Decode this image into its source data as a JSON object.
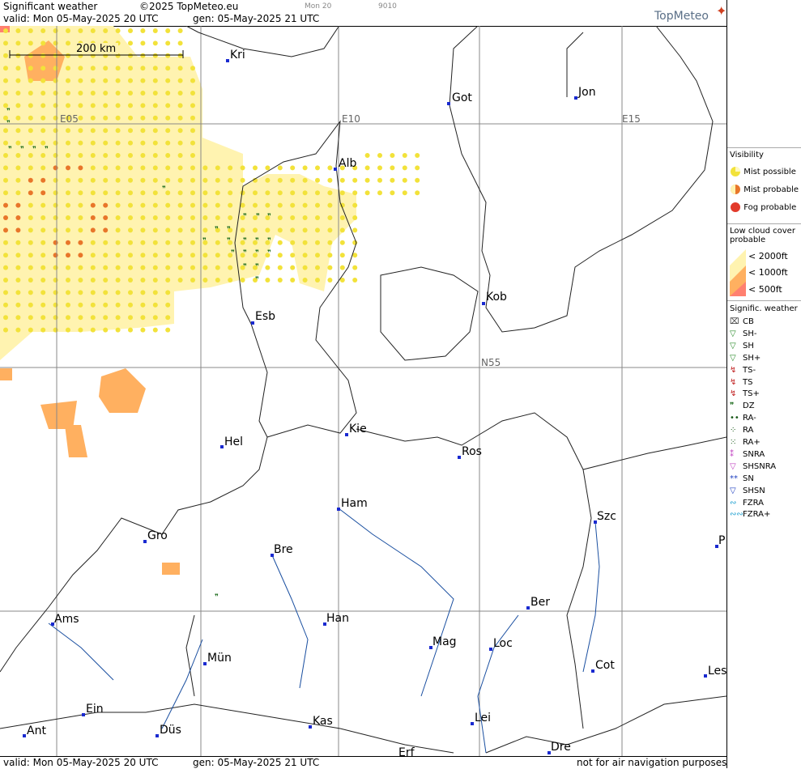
{
  "header": {
    "title": "Significant weather",
    "copyright": "©2025 TopMeteo.eu",
    "valid": "valid:  Mon  05-May-2025  20 UTC",
    "gen": "gen: 05-May-2025 21 UTC",
    "small_day": "Mon 20",
    "small_code": "9010",
    "logo": "TopMeteo"
  },
  "footer": {
    "valid": "valid:  Mon  05-May-2025  20 UTC",
    "gen": "gen: 05-May-2025 21 UTC",
    "disclaimer": "not for air navigation purposes"
  },
  "map": {
    "scale": "200 km",
    "grid_labels": [
      "E05",
      "E10",
      "E15",
      "N55"
    ],
    "cities": [
      "Kri",
      "Got",
      "Jon",
      "Alb",
      "Kob",
      "Esb",
      "Kie",
      "Hel",
      "Ros",
      "Ham",
      "Szc",
      "Gro",
      "Bre",
      "P",
      "Ams",
      "Han",
      "Ber",
      "Mag",
      "Loc",
      "Cot",
      "Mün",
      "Les",
      "Ein",
      "Kas",
      "Lei",
      "Ant",
      "Düs",
      "Dre",
      "Erf"
    ]
  },
  "legend": {
    "visibility_title": "Visibility",
    "mist_possible": "Mist possible",
    "mist_probable": "Mist probable",
    "fog_probable": "Fog probable",
    "low_cloud_title": "Low cloud cover probable",
    "lc_2000": "< 2000ft",
    "lc_1000": "< 1000ft",
    "lc_500": "<   500ft",
    "sigwx_title": "Signific. weather",
    "items": [
      "CB",
      "SH-",
      "SH",
      "SH+",
      "TS-",
      "TS",
      "TS+",
      "DZ",
      "RA-",
      "RA",
      "RA+",
      "SNRA",
      "SHSNRA",
      "SN",
      "SHSN",
      "FZRA",
      "FZRA+"
    ],
    "colors": {
      "mist_possible": "#f2e23a",
      "mist_probable": "#e8762a",
      "fog_probable": "#e23a2a",
      "lc_2000": "#fff3b0",
      "lc_1000": "#ffb060",
      "lc_500": "#ff8070"
    }
  }
}
